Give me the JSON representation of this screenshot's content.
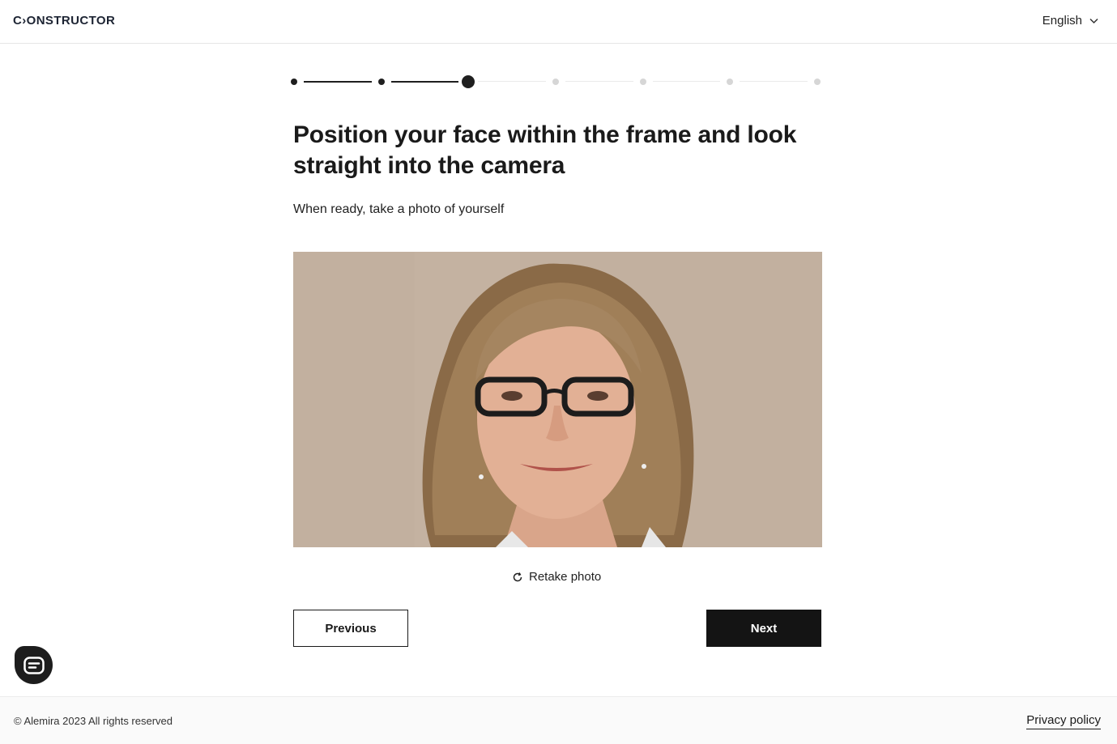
{
  "header": {
    "logo_text": "C›ONSTRUCTOR",
    "language": "English"
  },
  "stepper": {
    "total_steps": 7,
    "current_step": 3,
    "colors": {
      "done": "#1f1f1f",
      "pending": "#d6d6d6"
    }
  },
  "main": {
    "title": "Position your face within the frame and look straight into the camera",
    "subtitle": "When ready, take a photo of yourself",
    "retake_label": "Retake photo",
    "previous_label": "Previous",
    "next_label": "Next"
  },
  "footer": {
    "copyright": "© Alemira 2023 All rights reserved",
    "privacy_label": "Privacy policy"
  },
  "icons": {
    "language": "chevron-down-icon",
    "retake": "refresh-icon",
    "chat": "chat-icon"
  },
  "colors": {
    "primary_button": "#141414",
    "photo_background": "#c2b09f"
  }
}
